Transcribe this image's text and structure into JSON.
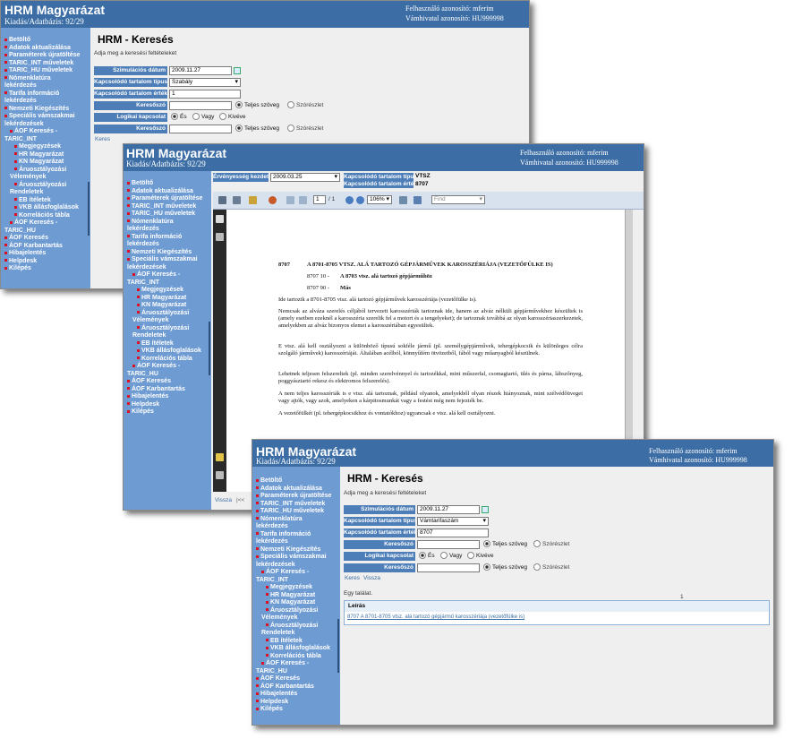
{
  "app": {
    "title": "HRM Magyarázat",
    "subtitle": "Kiadás/Adatbázis: 92/29",
    "user_line": "Felhasználó azonosító: mferim",
    "customs_line": "Vámhivatal azonosító: HU999998"
  },
  "nav": {
    "items": [
      "Betöltő",
      "Adatok aktualizálása",
      "Paraméterek újratöltése",
      "TARIC_INT műveletek",
      "TARIC_HU műveletek",
      "Nómenklatúra",
      "lekérdezés",
      "Tarifa információ",
      "lekérdezés",
      "Nemzeti Kiegészítés",
      "Speciális vámszakmai",
      "lekérdezések",
      "ÁOF Keresés -",
      "TARIC_INT",
      "Megjegyzések",
      "HR Magyarázat",
      "KN Magyarázat",
      "Áruosztályozási",
      "Vélemények",
      "Áruosztályozási",
      "Rendeletek",
      "EB ítéletek",
      "VKB állásfoglalások",
      "Korrelációs tábla",
      "ÁOF Keresés -",
      "TARIC_HU",
      "ÁOF Keresés",
      "ÁOF Karbantartás",
      "Hibajelentés",
      "Helpdesk",
      "Kilépés"
    ]
  },
  "search_form": {
    "page_title": "HRM - Keresés",
    "hint": "Adja meg a keresési feltételeket",
    "sim_date_label": "Szimulációs dátum",
    "sim_date_value": "2009.11.27",
    "content_type_label": "Kapcsolódó tartalom típus",
    "content_value_label": "Kapcsolódó tartalom érték",
    "keyword_label": "Keresőszó",
    "logic_label": "Logikai kapcsolat",
    "full_text": "Teljes szöveg",
    "fragment": "Szórészlet",
    "and": "És",
    "or": "Vagy",
    "except": "Kivéve",
    "search_button": "Keres",
    "back_button": "Vissza"
  },
  "window1": {
    "content_type_value": "Szabály",
    "content_value_value": "1"
  },
  "window3": {
    "content_type_value": "Vámtarifaszám",
    "content_value_value": "8707",
    "result_count": "Egy találat.",
    "page_number": "1",
    "result_header": "Leírás",
    "result_link": "8707 A 8701-8705 vtsz. alá tartozó gépjármű karosszériája (vezetőfülke is)"
  },
  "viewer": {
    "valid_from_label": "Érvényesség kezdete",
    "valid_from_value": "2009.03.25",
    "type_label": "Kapcsolódó tartalom típus",
    "type_value": "VTSZ",
    "value_label": "Kapcsolódó tartalom érték",
    "value_value": "8707",
    "page_input": "1",
    "page_total": "/ 1",
    "zoom": "106%",
    "find_placeholder": "Find",
    "back_link": "Vissza",
    "nav_first": "|<<",
    "doc": {
      "code": "8707",
      "heading": "A 8701-8705 VTSZ. ALÁ TARTOZÓ GÉPJÁRMŰVEK KAROSSZÉRIÁJA (VEZETŐFÜLKE IS)",
      "sub1_code": "8707 10 -",
      "sub1_text": "A 8703 vtsz. alá tartozó gépjárműhöz",
      "sub2_code": "8707 90 -",
      "sub2_text": "Más",
      "p1": "Ide tartozik a 8701-8705 vtsz. alá tartozó gépjárművek karosszériája (vezetőfülke is).",
      "p2": "Nemcsak az alváza szerelés céljából tervezett karosszériák tartoznak ide, hanem az alváz nélküli gépjárművekhez készültek is (amely esetben ezeknél a karosszéria szerelik fel a motort és a tengelyeket); de tartoznak továbbá az olyan karosszériaszerkezetek, amelyekben az alváz bizonyos elemei a karosszériában egyesültek.",
      "p3": "E vtsz. alá kell osztályozni a különböző típusú sokféle jármű (pl. személygépjárművek, tehergépkocsik és különleges célra szolgáló járművek) karosszériáját. Általában acélból, könnyűfém ötvözetből, fából vagy műanyagból készülnek.",
      "p4": "Lehetnek teljesen felszereltek (pl. minden szerelvénnyel és tartozékkal, mint műszerfal, csomagtartó, ülés és párna, lábszőnyeg, poggyásztartó rekesz és elektromos felszerelés).",
      "p5": "A nem teljes karosszériák is e vtsz. alá tartoznak, például olyanok, amelyekből olyan részek hiányoznak, mint szélvédőüveget vagy ajtók, vagy azok, amelyeken a kárpitosmunkát vagy a festést még nem fejezték be.",
      "p6": "A vezetőfülkét (pl. tehergépkocsikhoz és vontatókhoz) ugyancsak e vtsz. alá kell osztályozni."
    }
  },
  "colors": {
    "header": "#3c6ea5",
    "sidebar": "#6e9bd2",
    "label_bg": "#4d7eb8"
  }
}
